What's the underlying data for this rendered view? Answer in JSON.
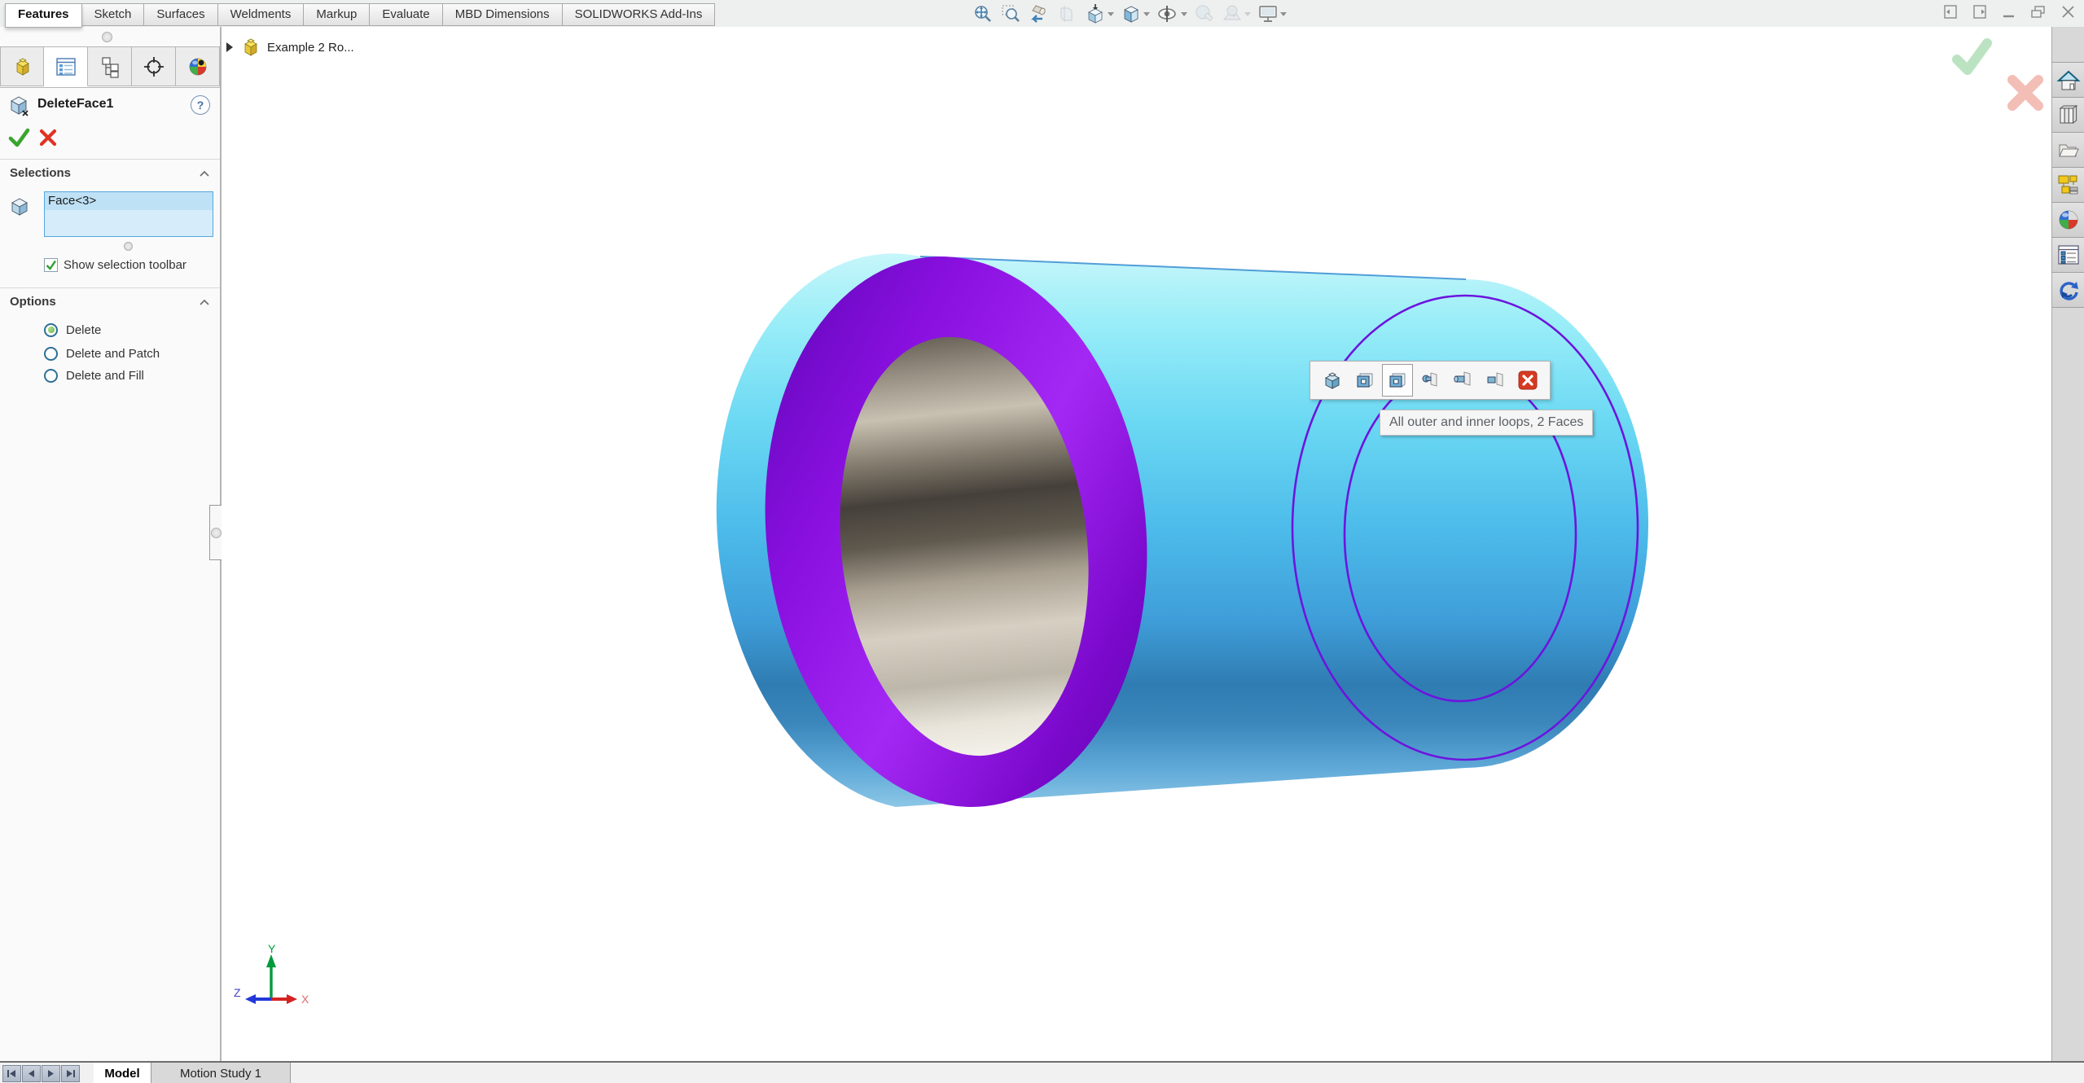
{
  "topbar": {
    "tabs": [
      "Features",
      "Sketch",
      "Surfaces",
      "Weldments",
      "Markup",
      "Evaluate",
      "MBD Dimensions",
      "SOLIDWORKS Add-Ins"
    ],
    "active_tab": "Features",
    "view_toolbar_icons": [
      "zoom-to-fit",
      "zoom-to-area",
      "previous-view",
      "section-view",
      "view-orientation",
      "display-style",
      "hide-show-items",
      "edit-appearance",
      "apply-scene",
      "view-settings"
    ],
    "window_controls": [
      "collapse-panel-left",
      "collapse-panel-right",
      "minimize",
      "restore",
      "close"
    ]
  },
  "property_manager": {
    "tabs": [
      "featuremanager-design-tree",
      "propertymanager",
      "configurationmanager",
      "dimxpertmanager",
      "displaymanager"
    ],
    "active_tab_index": 1,
    "title": "DeleteFace1",
    "help_icon": "?",
    "selections": {
      "header": "Selections",
      "items": [
        "Face<3>"
      ],
      "checkbox_label": "Show selection toolbar",
      "checkbox_checked": true
    },
    "options": {
      "header": "Options",
      "radios": [
        {
          "label": "Delete",
          "selected": true
        },
        {
          "label": "Delete and Patch",
          "selected": false
        },
        {
          "label": "Delete and Fill",
          "selected": false
        }
      ]
    }
  },
  "viewport": {
    "document_tab_label": "Example 2 Ro...",
    "selection_toolbar": {
      "buttons": [
        "part-faces",
        "outer-loops",
        "all-outer-and-inner-loops",
        "extend-selection-plug",
        "extend-selection-boss",
        "extend-selection-socket",
        "close"
      ],
      "hovered_button_index": 2,
      "tooltip": "All outer and inner loops, 2 Faces"
    },
    "triad": {
      "x_label": "X",
      "y_label": "Y",
      "z_label": "Z"
    },
    "model": {
      "description": "hollow tube, front ring face selected, rear face loops highlighted",
      "selected_face_color": "#8a12dd",
      "body_color": "#58c4ee",
      "bore_color": "#a89f90",
      "loop_highlight_color": "#6d14de"
    }
  },
  "task_pane": {
    "icons": [
      "home",
      "design-library",
      "file-explorer",
      "view-palette",
      "appearances-scenes",
      "custom-properties",
      "solidworks-resources"
    ]
  },
  "bottom_bar": {
    "nav_buttons": [
      "first",
      "previous",
      "next",
      "last"
    ],
    "tabs": [
      {
        "label": "Model",
        "active": true
      },
      {
        "label": "Motion Study 1",
        "active": false
      }
    ]
  }
}
